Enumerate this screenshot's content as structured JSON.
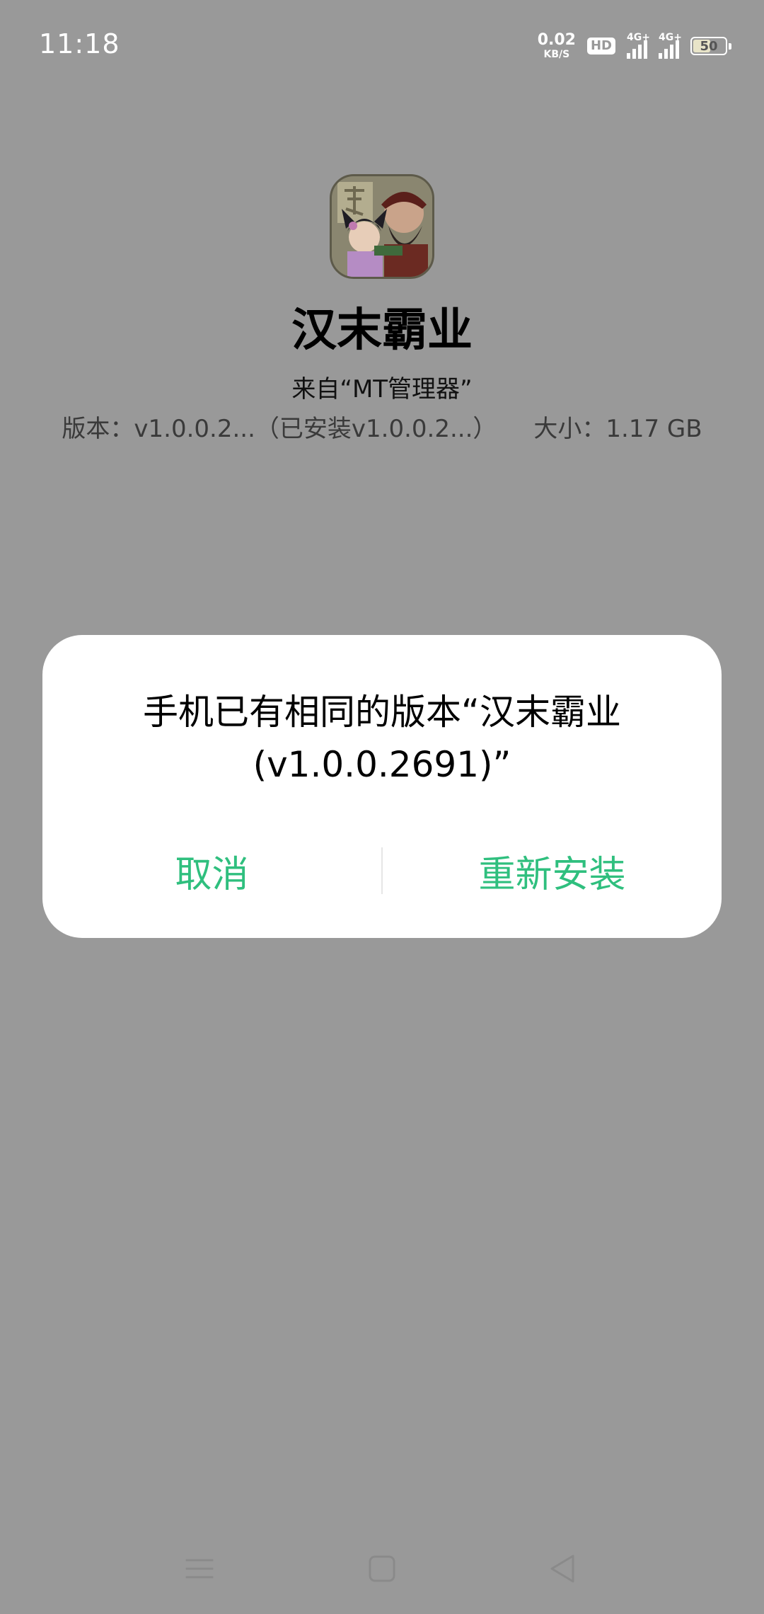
{
  "status_bar": {
    "time": "11:18",
    "net_speed_value": "0.02",
    "net_speed_unit": "KB/S",
    "hd_label": "HD",
    "signal1_label": "4G+",
    "signal2_label": "4G+",
    "battery_level": "50"
  },
  "app": {
    "icon_name": "app-icon",
    "name": "汉末霸业",
    "source": "来自“MT管理器”",
    "version": "版本：v1.0.0.2...（已安装v1.0.0.2...）",
    "size": "大小：1.17 GB"
  },
  "dialog": {
    "message": "手机已有相同的版本“汉末霸业(v1.0.0.2691)”",
    "cancel_label": "取消",
    "reinstall_label": "重新安装",
    "accent_color": "#2fbf7e"
  },
  "nav_bar": {
    "menu_icon": "menu-icon",
    "home_icon": "home-icon",
    "back_icon": "back-icon"
  }
}
